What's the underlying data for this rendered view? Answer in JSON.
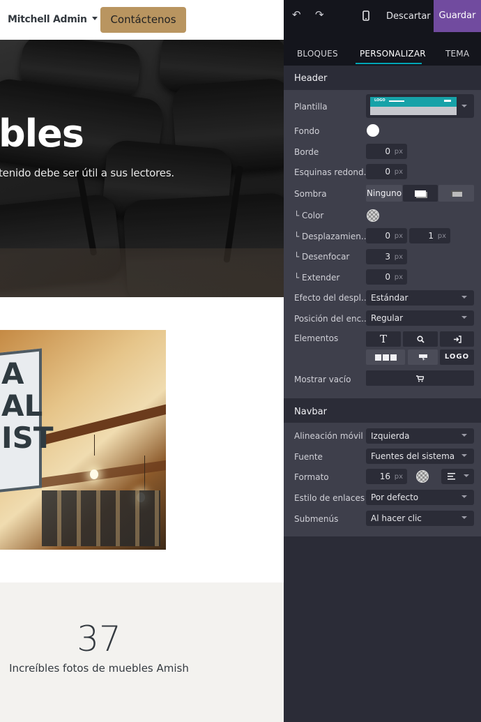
{
  "site": {
    "user_menu": "Mitchell Admin",
    "contact_button": "Contáctenos",
    "hero_title": "bles",
    "hero_subtitle": "tenido debe ser útil a sus lectores.",
    "photo_sign": "A\nAL\nIST",
    "stat_number": "37",
    "stat_label": "Increíbles fotos de muebles Amish"
  },
  "topbar": {
    "undo_icon": "undo-icon",
    "redo_icon": "redo-icon",
    "mobile_icon": "mobile-preview-icon",
    "discard_label": "Descartar",
    "save_label": "Guardar"
  },
  "tabs": [
    {
      "label": "BLOQUES"
    },
    {
      "label": "PERSONALIZAR",
      "active": true
    },
    {
      "label": "TEMA"
    }
  ],
  "header_section": {
    "title": "Header",
    "plantilla_label": "Plantilla",
    "plantilla_logo_text": "LOGO",
    "fondo_label": "Fondo",
    "fondo_color": "#ffffff",
    "borde_label": "Borde",
    "borde_value": "0",
    "esquinas_label": "Esquinas redond...",
    "esquinas_value": "0",
    "sombra_label": "Sombra",
    "sombra_none": "Ninguno",
    "color_label": "└ Color",
    "desplaz_label": "└ Desplazamien...",
    "desplaz_x": "0",
    "desplaz_y": "1",
    "desenfocar_label": "└ Desenfocar",
    "desenfocar_value": "3",
    "extender_label": "└ Extender",
    "extender_value": "0",
    "efecto_label": "Efecto del despl...",
    "efecto_value": "Estándar",
    "posicion_label": "Posición del enc...",
    "posicion_value": "Regular",
    "elementos_label": "Elementos",
    "elementos_text_glyph": "T",
    "elementos_logo": "LOGO",
    "mostrar_label": "Mostrar vacío",
    "unit": "px"
  },
  "navbar_section": {
    "title": "Navbar",
    "alineacion_label": "Alineación móvil",
    "alineacion_value": "Izquierda",
    "fuente_label": "Fuente",
    "fuente_value": "Fuentes del sistema",
    "formato_label": "Formato",
    "formato_value": "16",
    "estilo_label": "Estilo de enlaces",
    "estilo_value": "Por defecto",
    "submenus_label": "Submenús",
    "submenus_value": "Al hacer clic",
    "unit": "px"
  },
  "colors": {
    "accent_save": "#714b9f",
    "tab_underline": "#00a5b5",
    "contact_button": "#b99560"
  }
}
